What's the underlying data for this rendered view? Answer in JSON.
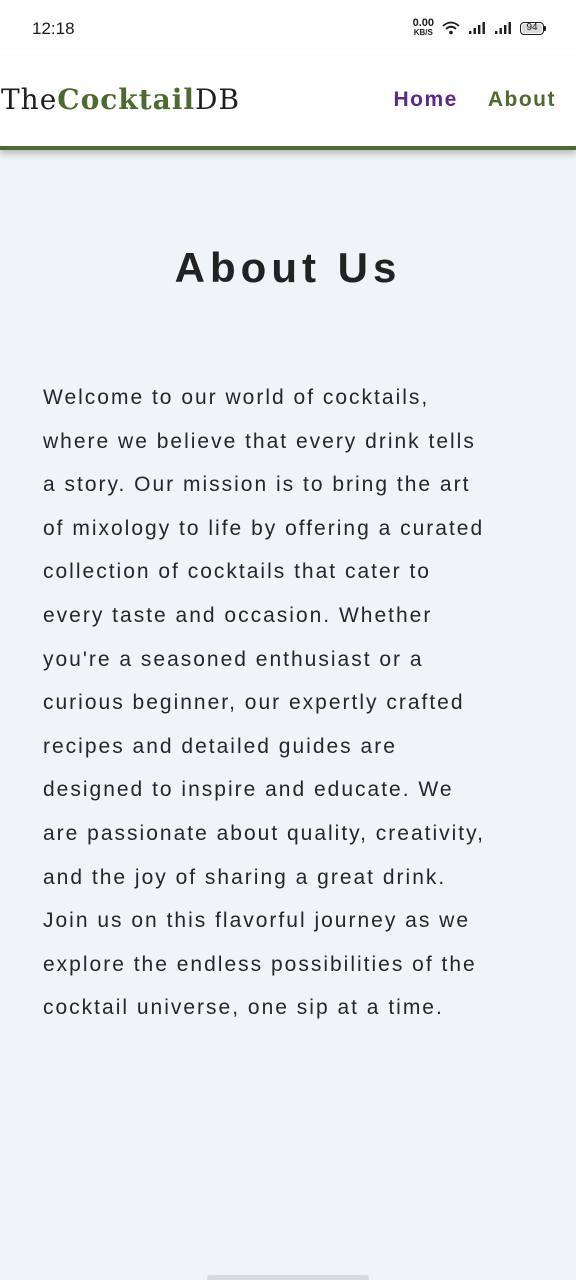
{
  "status_bar": {
    "time": "12:18",
    "net_speed_value": "0.00",
    "net_speed_unit": "KB/S",
    "battery_level": "94",
    "icons": [
      "wifi-icon",
      "signal-icon",
      "signal-icon",
      "battery-icon"
    ]
  },
  "navbar": {
    "logo_prefix": "The",
    "logo_highlight": "Cocktail",
    "logo_suffix": "DB",
    "links": [
      {
        "label": "Home",
        "color": "#5b2a86"
      },
      {
        "label": "About",
        "color": "#4e6a2e"
      }
    ],
    "accent_color": "#4e6a2e"
  },
  "main": {
    "title": "About Us",
    "paragraph_lines": [
      "Welcome to our world of cocktails,",
      "where we believe that every drink tells",
      "a story. Our mission is to bring the art",
      "of mixology to life by offering a curated",
      "collection of cocktails that cater to",
      "every taste and occasion. Whether",
      "you're a seasoned enthusiast or a",
      "curious beginner, our expertly crafted",
      "recipes and detailed guides are",
      "designed to inspire and educate. We",
      "are passionate about quality, creativity,",
      "and the joy of sharing a great drink.",
      "Join us on this flavorful journey as we",
      "explore the endless possibilities of the",
      "cocktail universe, one sip at a time."
    ]
  }
}
